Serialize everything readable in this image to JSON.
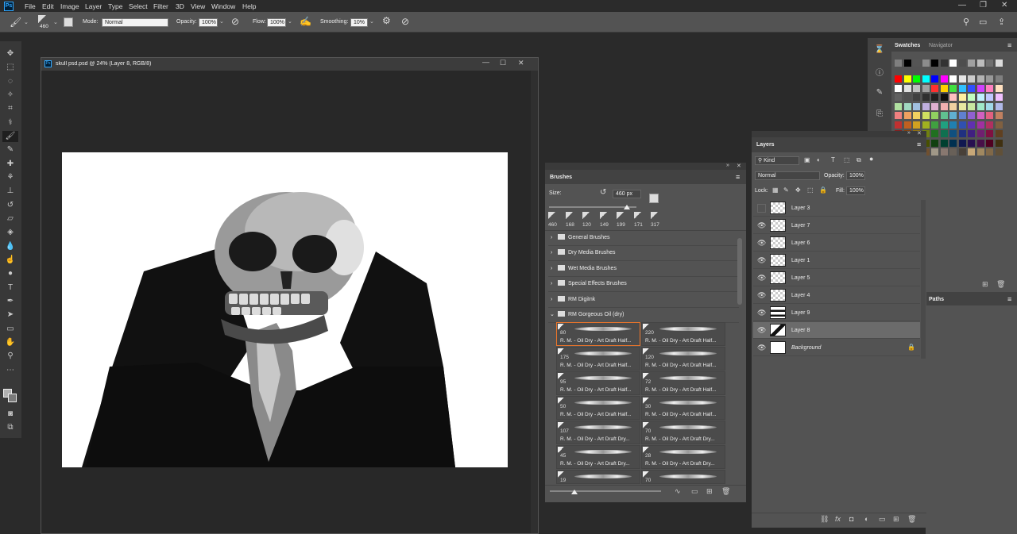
{
  "menu": {
    "ps_logo": "Ps",
    "items": [
      "File",
      "Edit",
      "Image",
      "Layer",
      "Type",
      "Select",
      "Filter",
      "3D",
      "View",
      "Window",
      "Help"
    ]
  },
  "options": {
    "brush_size": "460",
    "mode_label": "Mode:",
    "mode_value": "Normal",
    "opacity_label": "Opacity:",
    "opacity_value": "100%",
    "flow_label": "Flow:",
    "flow_value": "100%",
    "smoothing_label": "Smoothing:",
    "smoothing_value": "10%"
  },
  "document": {
    "ps_logo": "Ps",
    "title": "skull psd.psd @ 24% (Layer 8, RGB/8)"
  },
  "swatches_panel": {
    "tabs": [
      "Swatches",
      "Navigator"
    ],
    "top_row": [
      "#7f7f7f",
      "#000000",
      "#555555",
      "#8c8c8c",
      "#000000",
      "#333333",
      "#ffffff",
      "#4d4d4d",
      "#a0a0a0",
      "#bdbdbd",
      "#6f6f6f",
      "#dcdcdc"
    ],
    "grid": [
      [
        "#ff0000",
        "#ffff00",
        "#00ff00",
        "#00ffff",
        "#0000ff",
        "#ff00ff",
        "#ffffff",
        "#e6e6e6",
        "#cccccc",
        "#b3b3b3",
        "#999999",
        "#808080"
      ],
      [
        "#ffffff",
        "#e0e0e0",
        "#c0c0c0",
        "#a0a0a0",
        "#ff3030",
        "#ffd000",
        "#40e040",
        "#30c0ff",
        "#3050ff",
        "#d040ff",
        "#ff80c0",
        "#ffe0c0"
      ],
      [
        "#606060",
        "#505050",
        "#404040",
        "#303030",
        "#202020",
        "#101010",
        "#ffc0c0",
        "#fff0a0",
        "#c0ffc0",
        "#c0f0ff",
        "#c0c8ff",
        "#f0c0ff"
      ],
      [
        "#b0e0a0",
        "#a0d8c0",
        "#a0c0e0",
        "#c0b0e0",
        "#e0b0d0",
        "#f0b0b0",
        "#f0d0a0",
        "#e8e8a0",
        "#c8e8a0",
        "#a0e8c8",
        "#a0d8e8",
        "#b0b8e8"
      ],
      [
        "#f08080",
        "#f0a060",
        "#f0d060",
        "#d0e060",
        "#90d060",
        "#60c090",
        "#60b0d0",
        "#6080d0",
        "#9060d0",
        "#d060c0",
        "#e06080",
        "#c08060"
      ],
      [
        "#c03030",
        "#c06020",
        "#d0a020",
        "#a0b020",
        "#40a040",
        "#20a080",
        "#2080b0",
        "#3050b0",
        "#6030b0",
        "#a030a0",
        "#b03060",
        "#806040"
      ],
      [
        "#802020",
        "#804010",
        "#907010",
        "#708010",
        "#207020",
        "#107050",
        "#105080",
        "#203080",
        "#402080",
        "#702070",
        "#801040",
        "#604020"
      ],
      [
        "#500000",
        "#502000",
        "#604800",
        "#485000",
        "#104010",
        "#004030",
        "#003050",
        "#101850",
        "#281050",
        "#481048",
        "#500020",
        "#403010"
      ],
      [
        "#c8b090",
        "#b09070",
        "#907050",
        "#705030",
        "#a09888",
        "#887870",
        "#686058",
        "#484038",
        "#c8a878",
        "#a08860",
        "#806848",
        "#605038"
      ]
    ]
  },
  "right_icons": [
    "history-icon",
    "info-icon",
    "brush-settings-icon",
    "clone-source-icon",
    "properties-icon",
    "adjust-icon"
  ],
  "brushes_panel": {
    "title": "Brushes",
    "size_label": "Size:",
    "size_value": "460 px",
    "presets": [
      "460",
      "168",
      "120",
      "149",
      "199",
      "171",
      "317"
    ],
    "folders": [
      "General Brushes",
      "Dry Media Brushes",
      "Wet Media Brushes",
      "Special Effects Brushes",
      "RM DigiInk",
      "RM Gorgeous Oil (dry)"
    ],
    "tiles": [
      {
        "n": "80",
        "name": "R. M. - Oil Dry - Art Draft Half..."
      },
      {
        "n": "220",
        "name": "R. M. - Oil Dry - Art Draft Half..."
      },
      {
        "n": "175",
        "name": "R. M. - Oil Dry - Art Draft Half..."
      },
      {
        "n": "120",
        "name": "R. M. - Oil Dry - Art Draft Half..."
      },
      {
        "n": "95",
        "name": "R. M. - Oil Dry - Art Draft Half..."
      },
      {
        "n": "72",
        "name": "R. M. - Oil Dry - Art Draft Half..."
      },
      {
        "n": "50",
        "name": "R. M. - Oil Dry - Art Draft Half..."
      },
      {
        "n": "30",
        "name": "R. M. - Oil Dry - Art Draft Half..."
      },
      {
        "n": "107",
        "name": "R. M. - Oil Dry - Art Draft Dry..."
      },
      {
        "n": "70",
        "name": "R. M. - Oil Dry - Art Draft Dry..."
      },
      {
        "n": "45",
        "name": "R. M. - Oil Dry - Art Draft Dry..."
      },
      {
        "n": "28",
        "name": "R. M. - Oil Dry - Art Draft Dry..."
      },
      {
        "n": "19",
        "name": ""
      },
      {
        "n": "70",
        "name": ""
      }
    ]
  },
  "layers_panel": {
    "title": "Layers",
    "kind_label": "Kind",
    "blend_mode": "Normal",
    "opacity_label": "Opacity:",
    "opacity_value": "100%",
    "lock_label": "Lock:",
    "fill_label": "Fill:",
    "fill_value": "100%",
    "layers": [
      {
        "name": "Layer 3",
        "visible": false,
        "selected": false
      },
      {
        "name": "Layer 7",
        "visible": true,
        "selected": false
      },
      {
        "name": "Layer 6",
        "visible": true,
        "selected": false
      },
      {
        "name": "Layer 1",
        "visible": true,
        "selected": false
      },
      {
        "name": "Layer 5",
        "visible": true,
        "selected": false
      },
      {
        "name": "Layer 4",
        "visible": true,
        "selected": false
      },
      {
        "name": "Layer 9",
        "visible": true,
        "selected": false
      },
      {
        "name": "Layer 8",
        "visible": true,
        "selected": true
      },
      {
        "name": "Background",
        "visible": true,
        "selected": false
      }
    ]
  },
  "paths_panel": {
    "title": "Paths"
  },
  "colors": {
    "accent": "#e8742b",
    "panel": "#535353",
    "dark": "#2a2a2a"
  }
}
